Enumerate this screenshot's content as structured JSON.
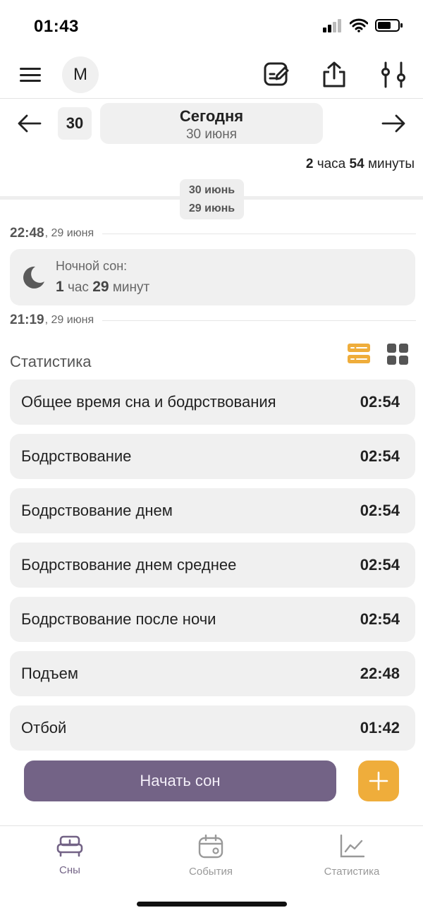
{
  "status_bar": {
    "time": "01:43"
  },
  "header": {
    "avatar_letter": "M"
  },
  "date_nav": {
    "day_chip": "30",
    "title": "Сегодня",
    "subtitle": "30 июня"
  },
  "total": {
    "hours": "2",
    "hours_unit": "часа",
    "minutes": "54",
    "minutes_unit": "минуты"
  },
  "day_badge": {
    "top": "30 июнь",
    "bottom": "29 июнь"
  },
  "timeline": {
    "start": {
      "time": "22:48",
      "date": ", 29 июня"
    },
    "end": {
      "time": "21:19",
      "date": ", 29 июня"
    },
    "sleep": {
      "label": "Ночной сон:",
      "hours": "1",
      "hours_unit": "час",
      "minutes": "29",
      "minutes_unit": "минут"
    }
  },
  "stats": {
    "title": "Статистика",
    "rows": [
      {
        "label": "Общее время сна и бодрствования",
        "value": "02:54"
      },
      {
        "label": "Бодрствование",
        "value": "02:54"
      },
      {
        "label": "Бодрствование днем",
        "value": "02:54"
      },
      {
        "label": "Бодрствование днем среднее",
        "value": "02:54"
      },
      {
        "label": "Бодрствование после ночи",
        "value": "02:54"
      },
      {
        "label": "Подъем",
        "value": "22:48"
      },
      {
        "label": "Отбой",
        "value": "01:42"
      }
    ]
  },
  "actions": {
    "start_sleep": "Начать сон"
  },
  "tabs": {
    "sleeps": "Сны",
    "events": "События",
    "statistics": "Статистика"
  },
  "colors": {
    "accent_purple": "#736386",
    "accent_orange": "#efad3b"
  }
}
